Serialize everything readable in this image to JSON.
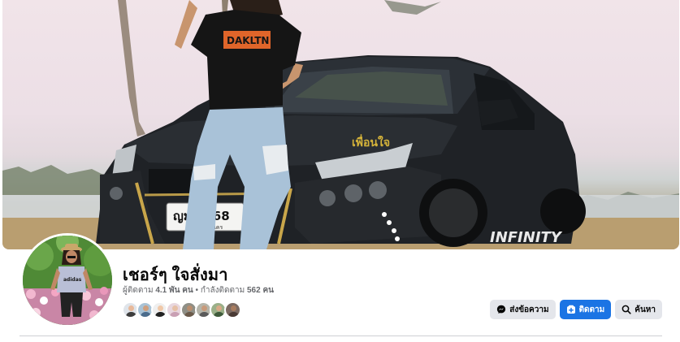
{
  "profile": {
    "name": "เชอร์ๆ ใจสั่งมา",
    "followers_label": "ผู้ติดตาม",
    "followers_value": "4.1 พัน คน",
    "separator": "•",
    "following_label": "กำลังติดตาม",
    "following_value": "562 คน"
  },
  "cover": {
    "shirt_text": "DAKLTN",
    "plate_text": "ญม 6368",
    "plate_sub": "นคร",
    "hood_decal": "เพื่อนใจ",
    "side_decal": "INFINITY"
  },
  "avatar": {
    "shirt_brand": "adidas"
  },
  "friends": [
    {
      "name": "friend-1",
      "skin": "#e8b99a",
      "shirt": "#3d3d3d",
      "bg": "#dfe4ea"
    },
    {
      "name": "friend-2",
      "skin": "#cf9f7e",
      "shirt": "#4b6c8c",
      "bg": "#a9c3d6"
    },
    {
      "name": "friend-3",
      "skin": "#f0c8a8",
      "shirt": "#222222",
      "bg": "#efefef"
    },
    {
      "name": "friend-4",
      "skin": "#e6c0a6",
      "shirt": "#c9a0b4",
      "bg": "#e8d7df"
    },
    {
      "name": "friend-5",
      "skin": "#b98d6e",
      "shirt": "#6b5a4a",
      "bg": "#8f8f86"
    },
    {
      "name": "friend-6",
      "skin": "#c89a7a",
      "shirt": "#5a5a5a",
      "bg": "#b5b5aa"
    },
    {
      "name": "friend-7",
      "skin": "#d9a987",
      "shirt": "#3f5a3b",
      "bg": "#9bb089"
    },
    {
      "name": "friend-8",
      "skin": "#a97d60",
      "shirt": "#4a3a34",
      "bg": "#7c6b63"
    }
  ],
  "actions": {
    "message_label": "ส่งข้อความ",
    "follow_label": "ติดตาม",
    "search_label": "ค้นหา"
  },
  "colors": {
    "primary_blue": "#1b74e4",
    "button_grey": "#e4e6eb",
    "secondary_text": "#65676b",
    "divider": "#ced0d4"
  }
}
